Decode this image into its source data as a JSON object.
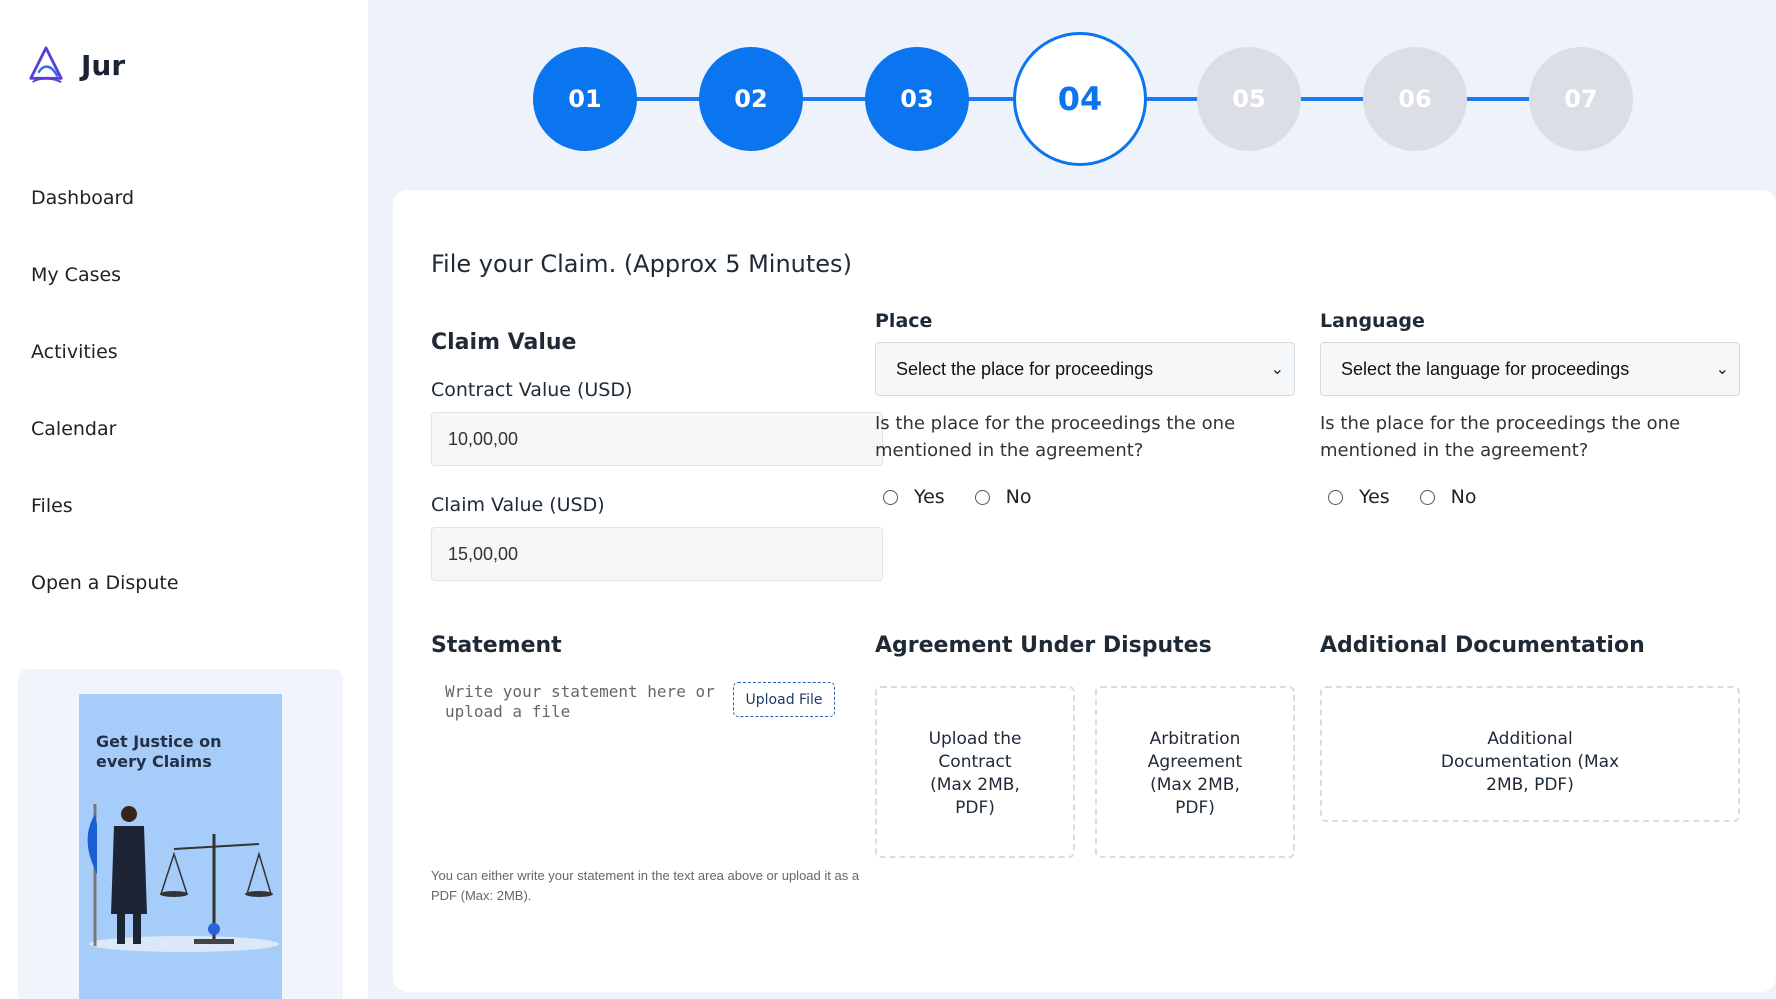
{
  "brand": {
    "name": "Jur"
  },
  "sidebar": {
    "items": [
      {
        "label": "Dashboard"
      },
      {
        "label": "My Cases"
      },
      {
        "label": "Activities"
      },
      {
        "label": "Calendar"
      },
      {
        "label": "Files"
      },
      {
        "label": "Open a Dispute"
      }
    ],
    "promo": {
      "text": "Get Justice on every Claims"
    }
  },
  "stepper": {
    "steps": [
      "01",
      "02",
      "03",
      "04",
      "05",
      "06",
      "07"
    ],
    "current": "04"
  },
  "form": {
    "title": "File your Claim. (Approx 5 Minutes)",
    "claim_value": {
      "heading": "Claim Value",
      "contract_label": "Contract Value (USD)",
      "contract_value": "10,00,00",
      "claim_label": "Claim Value (USD)",
      "claim_value": "15,00,00"
    },
    "place": {
      "heading": "Place",
      "select_value": "Select the place for proceedings",
      "question": "Is the place for the proceedings the one mentioned in the agreement?",
      "yes": "Yes",
      "no": "No"
    },
    "language": {
      "heading": "Language",
      "select_value": "Select the language for proceedings",
      "question": "Is the place for the proceedings the one mentioned in the agreement?",
      "yes": "Yes",
      "no": "No"
    },
    "statement": {
      "heading": "Statement",
      "placeholder": "Write your statement here or upload a file",
      "upload_label": "Upload File",
      "hint": "You can either write your statement in the text area above or upload it as a PDF (Max: 2MB)."
    },
    "agreement": {
      "heading": "Agreement Under Disputes",
      "contract_drop": "Upload the Contract (Max 2MB, PDF)",
      "arbitration_drop": "Arbitration Agreement (Max 2MB, PDF)"
    },
    "additional": {
      "heading": "Additional Documentation",
      "drop": "Additional Documentation (Max 2MB, PDF)"
    }
  },
  "colors": {
    "accent": "#0a75ee",
    "pending": "#dcdee5",
    "background": "#eef2fa",
    "promo": "#a6cdfa"
  }
}
